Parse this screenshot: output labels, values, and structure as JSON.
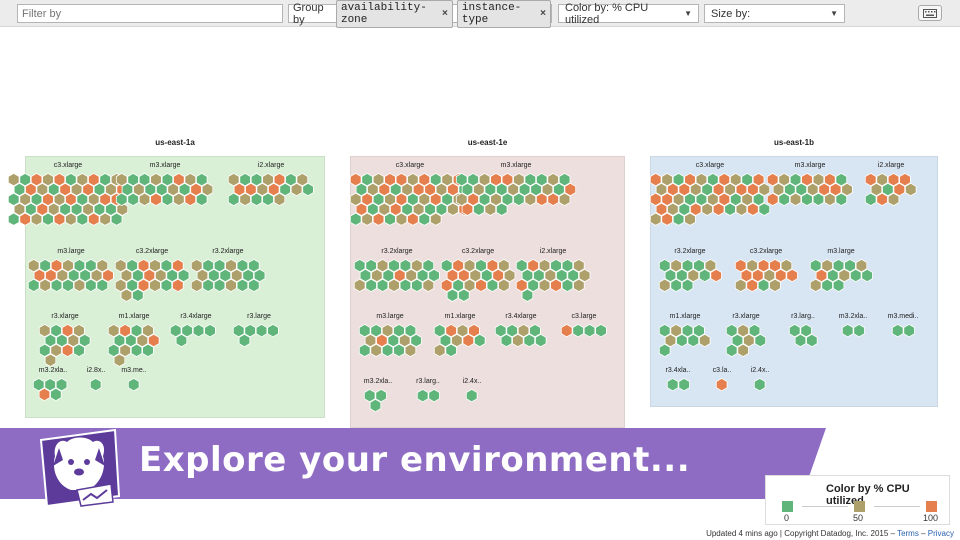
{
  "toolbar": {
    "filter_placeholder": "Filter by",
    "group_by_label": "Group by",
    "group_tags": [
      "availability-zone",
      "instance-type"
    ],
    "remove_glyph": "×",
    "color_by": "Color by: % CPU utilized",
    "size_by": "Size by:",
    "caret": "▼",
    "keyboard_icon": "keyboard-icon"
  },
  "colors": {
    "green": "#5fb57a",
    "olive": "#aea06a",
    "orange": "#e57f4d",
    "zone1_bg": "#d9efd6",
    "zone2_bg": "#ecdfdd",
    "zone3_bg": "#d8e5f2",
    "banner": "#8e6cc4"
  },
  "zones": [
    {
      "title": "us-east-1a",
      "groups": [
        {
          "label": "c3.xlarge",
          "hexes": "OGOOOGOOGOGOGGOGOGGOGGGOOOGGOOGGOOGGOGGGGOGGOGGOGG"
        },
        {
          "label": "m3.xlarge",
          "hexes": "GGGOGOGGGGGGGGOGGGGOGGOG"
        },
        {
          "label": "i2.xlarge",
          "hexes": "GGGGOGGOOGOGGGGOGGG"
        },
        {
          "label": "m3.large",
          "hexes": "GGOOGGGOOGGGGOGOGGGGG"
        },
        {
          "label": "c3.2xlarge",
          "hexes": "OGOOGOGGOOGGOGOOGOGG"
        },
        {
          "label": "r3.2xlarge",
          "hexes": "GGGGGGGGGGGGGGGGGG"
        },
        {
          "label": "r3.xlarge",
          "hexes": "GGOGGGOGGGOGG"
        },
        {
          "label": "m1.xlarge",
          "hexes": "GOGGGGGOGOGGG"
        },
        {
          "label": "r3.4xlarge",
          "hexes": "GGGGG"
        },
        {
          "label": "r3.large",
          "hexes": "GGGGG"
        },
        {
          "label": "m3.2xla..",
          "hexes": "GGGOG"
        },
        {
          "label": "i2.8x..",
          "hexes": "G"
        },
        {
          "label": "m3.me..",
          "hexes": "G"
        }
      ]
    },
    {
      "title": "us-east-1e",
      "groups": [
        {
          "label": "c3.xlarge",
          "hexes": "OGOOOGOGGOGOOGOOOGOGGOGOOGOOGOOGOOGOGGOOGGOGOOGO"
        },
        {
          "label": "m3.xlarge",
          "hexes": "GGGOOOGGOGGOGGGGGGGOGOGGGGGOOGOGGG"
        },
        {
          "label": "r3.2xlarge",
          "hexes": "GGGGGGGGGGOGGGGGGGGGG"
        },
        {
          "label": "c3.2xlarge",
          "hexes": "GOOGOGOOGGOGOGGOGOGG"
        },
        {
          "label": "i2.xlarge",
          "hexes": "GOOGGOGGOGGOOGGOGGG"
        },
        {
          "label": "m3.large",
          "hexes": "GGGGGGOGGGGOGGG"
        },
        {
          "label": "m1.xlarge",
          "hexes": "GOGOGGOGGG"
        },
        {
          "label": "r3.4xlarge",
          "hexes": "GGOGGGGG"
        },
        {
          "label": "c3.large",
          "hexes": "OGGG"
        },
        {
          "label": "m3.2xla..",
          "hexes": "GGG"
        },
        {
          "label": "r3.larg..",
          "hexes": "GG"
        },
        {
          "label": "i2.4x..",
          "hexes": "G"
        }
      ]
    },
    {
      "title": "us-east-1b",
      "groups": [
        {
          "label": "c3.xlarge",
          "hexes": "OOGOGGOOGOGOOOGOGOOGOOOGGOOGOGOOGOOOGGOGGOGG"
        },
        {
          "label": "m3.xlarge",
          "hexes": "OGGOGOGGGGGOOGOGGGGGG"
        },
        {
          "label": "i2.xlarge",
          "hexes": "OGOOGGOGGOG"
        },
        {
          "label": "r3.2xlarge",
          "hexes": "GGGGGGGGGOGGG"
        },
        {
          "label": "c3.2xlarge",
          "hexes": "OOOOGOOGOOOOGO"
        },
        {
          "label": "m3.large",
          "hexes": "GOGGGOGOGGGGG"
        },
        {
          "label": "m1.xlarge",
          "hexes": "GGGGGGGGG"
        },
        {
          "label": "r3.xlarge",
          "hexes": "GGGGGGGG"
        },
        {
          "label": "r3.larg..",
          "hexes": "GGGG"
        },
        {
          "label": "m3.2xla..",
          "hexes": "GG"
        },
        {
          "label": "m3.medi..",
          "hexes": "GG"
        },
        {
          "label": "r3.4xla..",
          "hexes": "GG"
        },
        {
          "label": "c3.la..",
          "hexes": "O"
        },
        {
          "label": "i2.4x..",
          "hexes": "G"
        }
      ]
    }
  ],
  "banner": {
    "text": "Explore your environment..."
  },
  "legend": {
    "title": "Color by % CPU utilized",
    "min": "0",
    "mid": "50",
    "max": "100"
  },
  "footer": {
    "updated": "Updated 4 mins ago",
    "sep": "|",
    "copyright": "Copyright Datadog, Inc. 2015",
    "dash": "–",
    "terms": "Terms",
    "dash2": "–",
    "privacy": "Privacy"
  }
}
